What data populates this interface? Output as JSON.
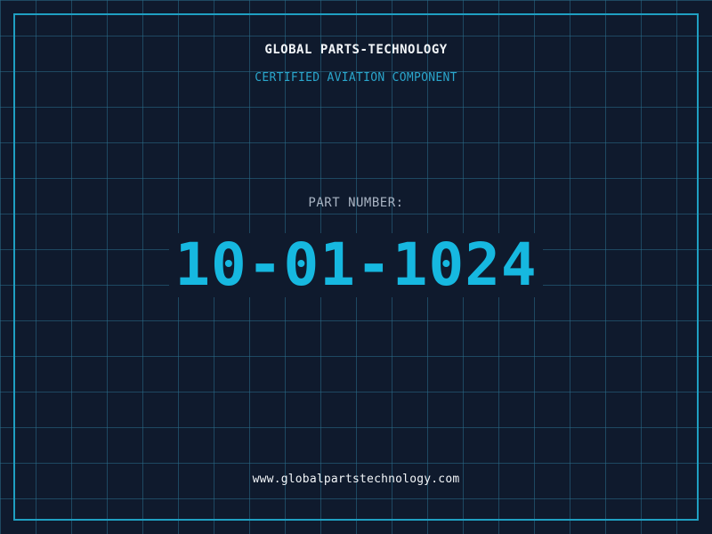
{
  "header": {
    "company_name": "GLOBAL PARTS-TECHNOLOGY",
    "tagline": "CERTIFIED AVIATION COMPONENT"
  },
  "part": {
    "label": "PART NUMBER:",
    "number": "10-01-1024"
  },
  "footer": {
    "website": "www.globalpartstechnology.com"
  },
  "colors": {
    "background": "#0f1a2d",
    "grid": "#2a6e8c",
    "frame": "#1f9fc2",
    "accent": "#16b8e0",
    "tagline": "#2aa6cc",
    "label": "#a9b4c3",
    "text": "#f2f5f8"
  }
}
